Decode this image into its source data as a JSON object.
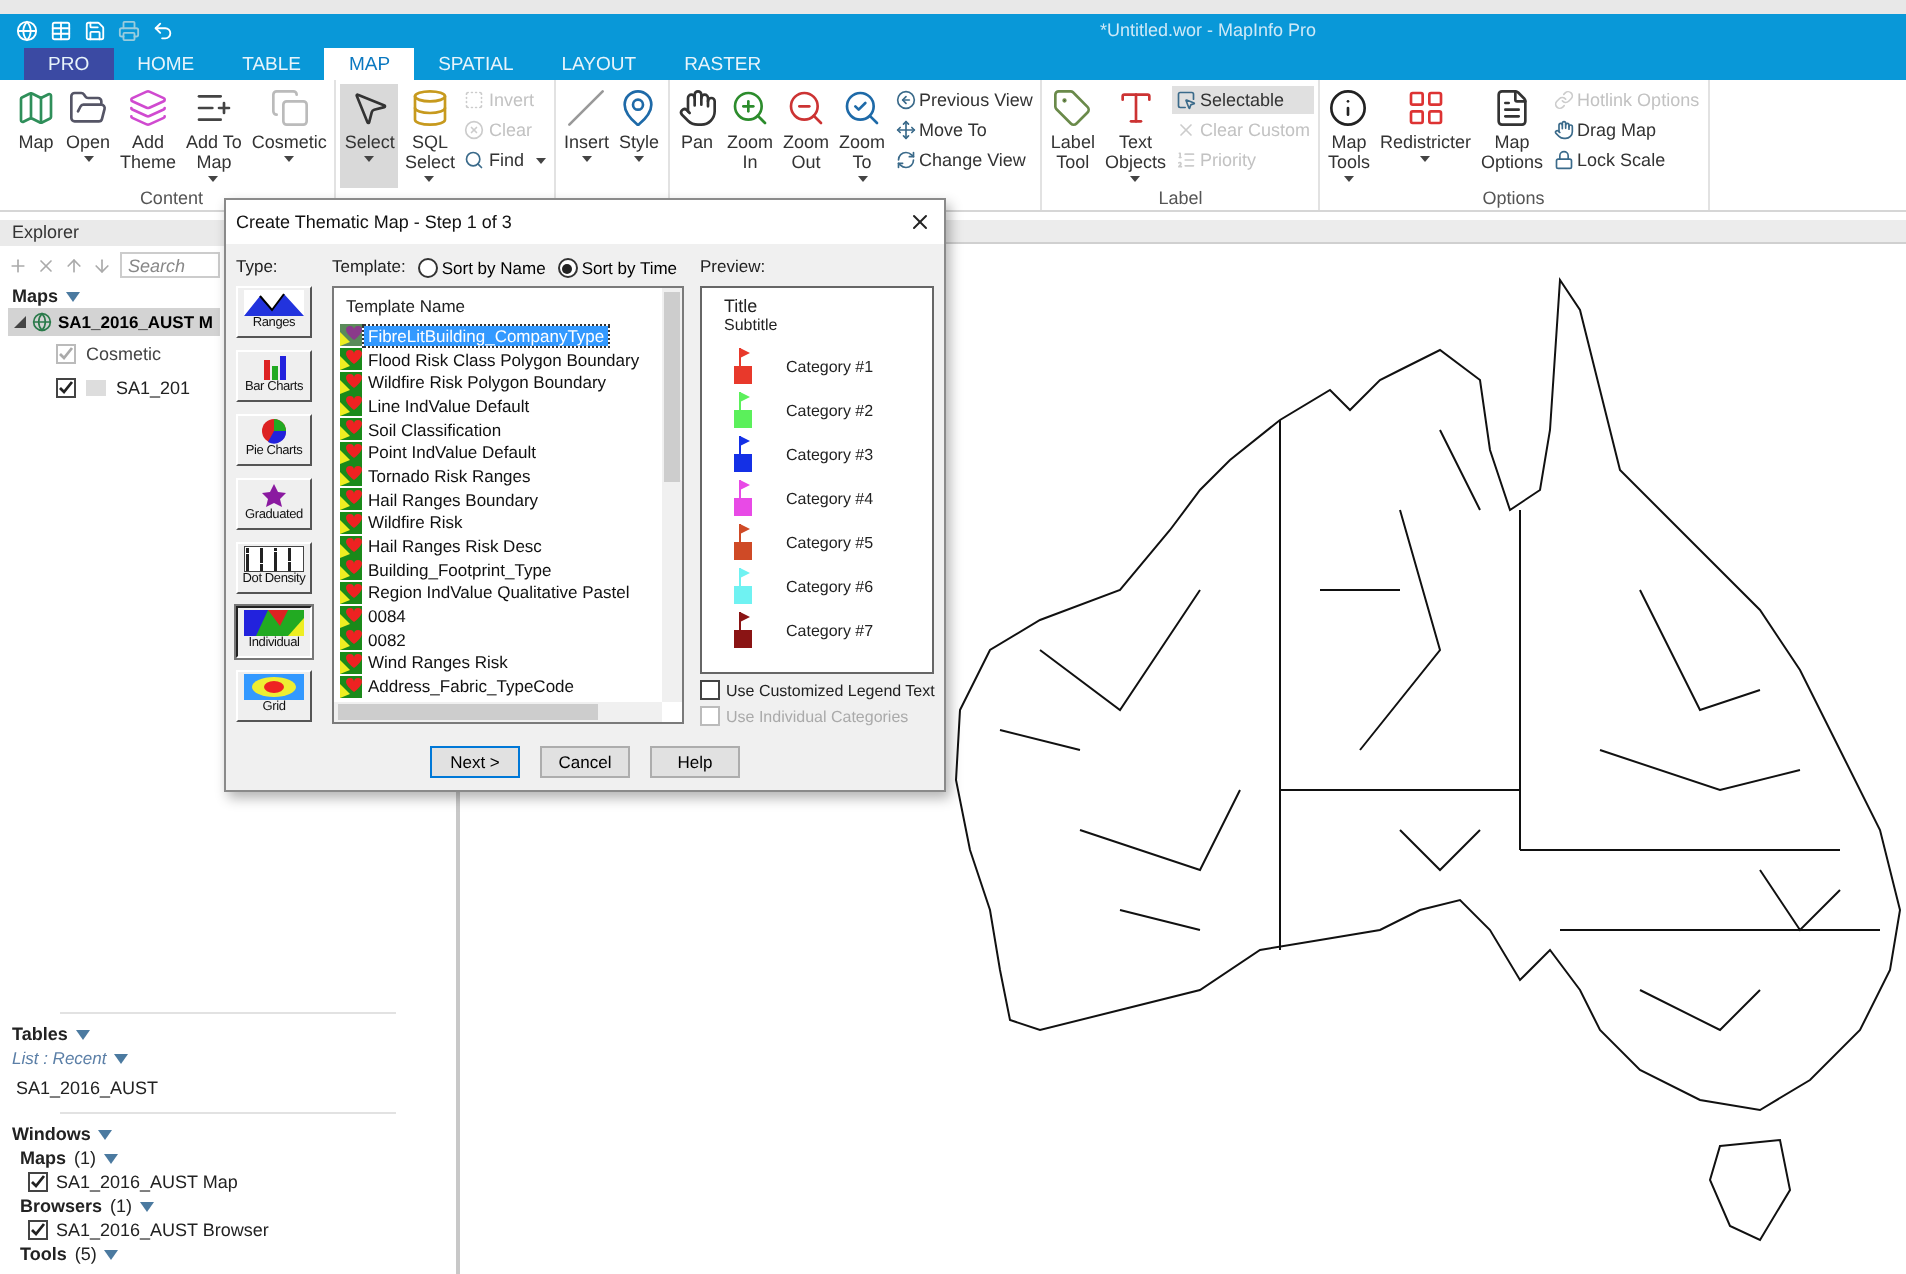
{
  "window": {
    "title": "*Untitled.wor - MapInfo Pro"
  },
  "tabs": [
    {
      "label": "PRO",
      "kind": "app",
      "selected": false
    },
    {
      "label": "HOME",
      "kind": "tab",
      "selected": false
    },
    {
      "label": "TABLE",
      "kind": "tab",
      "selected": false
    },
    {
      "label": "MAP",
      "kind": "tab",
      "selected": true
    },
    {
      "label": "SPATIAL",
      "kind": "tab",
      "selected": false
    },
    {
      "label": "LAYOUT",
      "kind": "tab",
      "selected": false
    },
    {
      "label": "RASTER",
      "kind": "tab",
      "selected": false
    }
  ],
  "ribbon": {
    "groups": [
      {
        "label": "Content",
        "large": [
          {
            "label": "Map",
            "dropdown": false,
            "selected": false
          },
          {
            "label": "Open",
            "dropdown": true,
            "selected": false
          },
          {
            "label": "Add\nTheme",
            "dropdown": false,
            "selected": false
          },
          {
            "label": "Add To\nMap",
            "dropdown": true,
            "selected": false
          },
          {
            "label": "Cosmetic",
            "dropdown": true,
            "selected": false
          }
        ]
      },
      {
        "large": [
          {
            "label": "Select",
            "dropdown": true,
            "selected": true
          },
          {
            "label": "SQL\nSelect",
            "dropdown": true,
            "selected": false
          }
        ],
        "small": [
          {
            "label": "Invert",
            "disabled": true,
            "selected": false,
            "dropdown": false
          },
          {
            "label": "Clear",
            "disabled": true,
            "selected": false,
            "dropdown": false
          },
          {
            "label": "Find",
            "disabled": false,
            "selected": false,
            "dropdown": true
          }
        ]
      },
      {
        "large": [
          {
            "label": "Insert",
            "dropdown": true,
            "selected": false
          },
          {
            "label": "Style",
            "dropdown": true,
            "selected": false
          }
        ]
      },
      {
        "large": [
          {
            "label": "Pan",
            "dropdown": false,
            "selected": false
          },
          {
            "label": "Zoom\nIn",
            "dropdown": false,
            "selected": false
          },
          {
            "label": "Zoom\nOut",
            "dropdown": false,
            "selected": false
          },
          {
            "label": "Zoom\nTo",
            "dropdown": true,
            "selected": false
          }
        ],
        "small": [
          {
            "label": "Previous View",
            "disabled": false,
            "selected": false,
            "dropdown": false
          },
          {
            "label": "Move To",
            "disabled": false,
            "selected": false,
            "dropdown": false
          },
          {
            "label": "Change View",
            "disabled": false,
            "selected": false,
            "dropdown": false
          }
        ]
      },
      {
        "label": "Label",
        "large": [
          {
            "label": "Label\nTool",
            "dropdown": false,
            "selected": false
          },
          {
            "label": "Text\nObjects",
            "dropdown": true,
            "selected": false
          }
        ],
        "small": [
          {
            "label": "Selectable",
            "disabled": false,
            "selected": true,
            "dropdown": false
          },
          {
            "label": "Clear Custom",
            "disabled": true,
            "selected": false,
            "dropdown": false
          },
          {
            "label": "Priority",
            "disabled": true,
            "selected": false,
            "dropdown": false
          }
        ]
      },
      {
        "label": "Options",
        "large": [
          {
            "label": "Map\nTools",
            "dropdown": true,
            "selected": false
          },
          {
            "label": "Redistricter",
            "dropdown": true,
            "selected": false
          },
          {
            "label": "Map\nOptions",
            "dropdown": false,
            "selected": false
          }
        ],
        "small": [
          {
            "label": "Hotlink Options",
            "disabled": true,
            "selected": false,
            "dropdown": false
          },
          {
            "label": "Drag Map",
            "disabled": false,
            "selected": false,
            "dropdown": false
          },
          {
            "label": "Lock Scale",
            "disabled": false,
            "selected": false,
            "dropdown": false
          }
        ]
      }
    ]
  },
  "explorer": {
    "title": "Explorer",
    "search": {
      "placeholder": "Search"
    },
    "maps": {
      "label": "Maps",
      "items": [
        {
          "label": "SA1_2016_AUST M",
          "expanded": true,
          "children": [
            {
              "label": "Cosmetic",
              "checked": true,
              "disabled": true
            },
            {
              "label": "SA1_201",
              "checked": true,
              "disabled": false
            }
          ]
        }
      ]
    },
    "tables": {
      "label": "Tables",
      "list_mode": "List : Recent",
      "items": [
        "SA1_2016_AUST"
      ]
    },
    "windows": {
      "label": "Windows",
      "groups": [
        {
          "label": "Maps",
          "count": "(1)",
          "items": [
            {
              "label": "SA1_2016_AUST Map",
              "checked": true
            }
          ]
        },
        {
          "label": "Browsers",
          "count": "(1)",
          "items": [
            {
              "label": "SA1_2016_AUST Browser",
              "checked": true
            }
          ]
        },
        {
          "label": "Tools",
          "count": "(5)"
        }
      ]
    }
  },
  "dialog": {
    "title": "Create Thematic Map - Step 1 of 3",
    "type_label": "Type:",
    "template_label": "Template:",
    "sort": [
      {
        "label": "Sort by Name",
        "selected": false
      },
      {
        "label": "Sort by Time",
        "selected": true
      }
    ],
    "types": [
      {
        "label": "Ranges",
        "selected": false
      },
      {
        "label": "Bar Charts",
        "selected": false
      },
      {
        "label": "Pie Charts",
        "selected": false
      },
      {
        "label": "Graduated",
        "selected": false
      },
      {
        "label": "Dot Density",
        "selected": false
      },
      {
        "label": "Individual",
        "selected": true
      },
      {
        "label": "Grid",
        "selected": false
      }
    ],
    "template_header": "Template Name",
    "templates": [
      {
        "label": "FibreLitBuilding_CompanyType",
        "selected": true
      },
      {
        "label": "Flood Risk Class Polygon Boundary",
        "selected": false
      },
      {
        "label": "Wildfire Risk Polygon Boundary",
        "selected": false
      },
      {
        "label": "Line IndValue Default",
        "selected": false
      },
      {
        "label": "Soil Classification",
        "selected": false
      },
      {
        "label": "Point IndValue Default",
        "selected": false
      },
      {
        "label": "Tornado Risk Ranges",
        "selected": false
      },
      {
        "label": "Hail Ranges Boundary",
        "selected": false
      },
      {
        "label": "Wildfire Risk",
        "selected": false
      },
      {
        "label": "Hail Ranges Risk Desc",
        "selected": false
      },
      {
        "label": "Building_Footprint_Type",
        "selected": false
      },
      {
        "label": "Region IndValue Qualitative Pastel",
        "selected": false
      },
      {
        "label": "0084",
        "selected": false
      },
      {
        "label": "0082",
        "selected": false
      },
      {
        "label": "Wind Ranges Risk",
        "selected": false
      },
      {
        "label": "Address_Fabric_TypeCode",
        "selected": false
      }
    ],
    "preview_label": "Preview:",
    "preview": {
      "title": "Title",
      "subtitle": "Subtitle",
      "categories": [
        {
          "label": "Category #1",
          "color": "#e8392b"
        },
        {
          "label": "Category #2",
          "color": "#5bf05b"
        },
        {
          "label": "Category #3",
          "color": "#1430e6"
        },
        {
          "label": "Category #4",
          "color": "#e84ae6"
        },
        {
          "label": "Category #5",
          "color": "#cf4a26"
        },
        {
          "label": "Category #6",
          "color": "#6ff2f2"
        },
        {
          "label": "Category #7",
          "color": "#8a1414"
        }
      ]
    },
    "options": [
      {
        "label": "Use Customized Legend Text",
        "checked": false,
        "disabled": false
      },
      {
        "label": "Use Individual Categories",
        "checked": false,
        "disabled": true
      }
    ],
    "buttons": [
      {
        "label": "Next >",
        "default": true
      },
      {
        "label": "Cancel",
        "default": false
      },
      {
        "label": "Help",
        "default": false
      }
    ]
  }
}
